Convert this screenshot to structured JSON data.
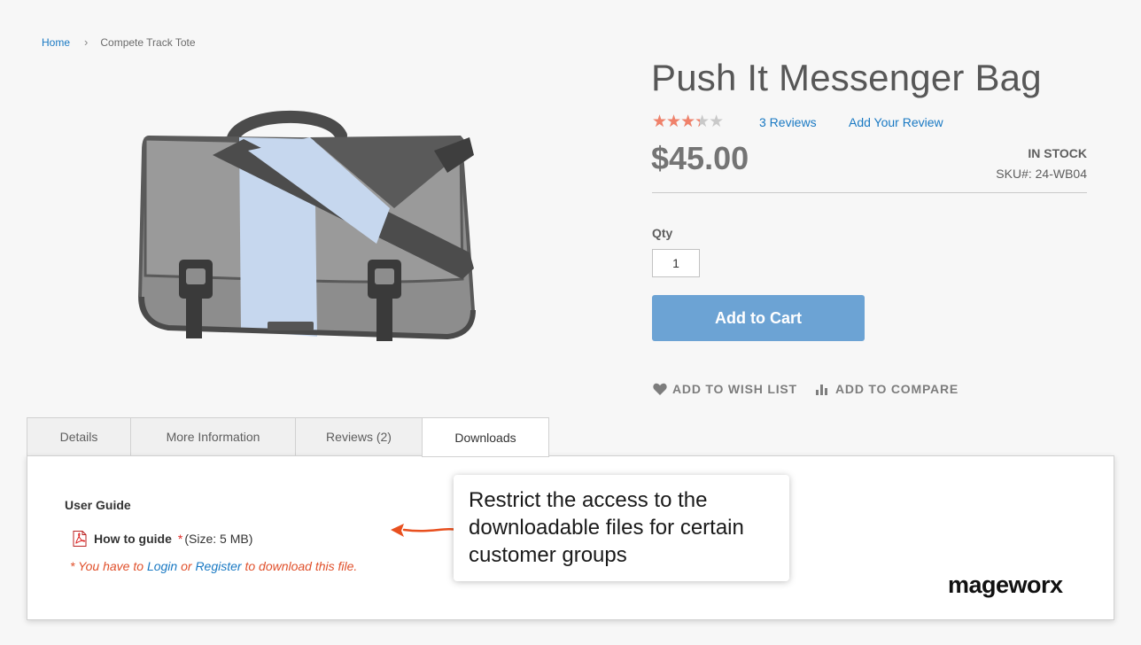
{
  "breadcrumb": {
    "home": "Home",
    "separator": "›",
    "current": "Compete Track Tote"
  },
  "product": {
    "title": "Push It Messenger Bag",
    "rating_fraction": 0.6,
    "reviews_count_label": "3  Reviews",
    "add_review_label": "Add Your Review",
    "price": "$45.00",
    "stock_status": "IN STOCK",
    "sku": "SKU#:  24-WB04",
    "qty_label": "Qty",
    "qty_value": "1",
    "add_to_cart_label": "Add to Cart",
    "wishlist_label": "ADD TO WISH LIST",
    "compare_label": "ADD TO COMPARE",
    "image_icon": "messenger-bag-image"
  },
  "tabs": [
    {
      "label": "Details"
    },
    {
      "label": "More Information"
    },
    {
      "label": "Reviews (2)"
    },
    {
      "label": "Downloads",
      "active": true
    }
  ],
  "downloads": {
    "section_title": "User Guide",
    "file_icon": "pdf-icon",
    "file_name": "How to guide",
    "required_marker": "*",
    "file_size": "(Size: 5 MB)",
    "note_prefix": "* You have to ",
    "login_label": "Login",
    "note_or": " or ",
    "register_label": "Register",
    "note_suffix": " to download this file."
  },
  "callout": {
    "text": "Restrict the access to the downloadable files for certain customer groups"
  },
  "brand": {
    "name": "mageworx"
  },
  "colors": {
    "link": "#1979c3",
    "button": "#6ca3d4",
    "star": "#f0816a",
    "note": "#e0502b",
    "arrow": "#e8501f"
  }
}
